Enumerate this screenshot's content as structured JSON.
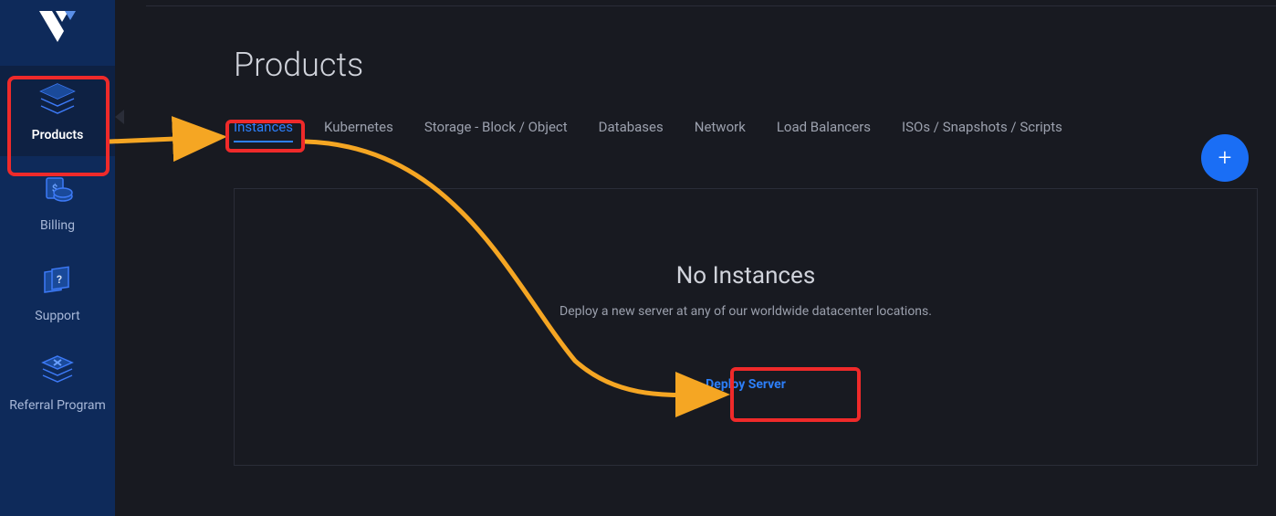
{
  "sidebar": {
    "items": [
      {
        "label": "Products"
      },
      {
        "label": "Billing"
      },
      {
        "label": "Support"
      },
      {
        "label": "Referral Program"
      }
    ]
  },
  "page": {
    "title": "Products"
  },
  "tabs": [
    {
      "label": "Instances"
    },
    {
      "label": "Kubernetes"
    },
    {
      "label": "Storage - Block / Object"
    },
    {
      "label": "Databases"
    },
    {
      "label": "Network"
    },
    {
      "label": "Load Balancers"
    },
    {
      "label": "ISOs / Snapshots / Scripts"
    }
  ],
  "empty": {
    "title": "No Instances",
    "subtitle": "Deploy a new server at any of our worldwide datacenter locations.",
    "button": "Deploy Server"
  },
  "colors": {
    "accent": "#2d7ff9",
    "highlight": "#ef2a2a",
    "arrow": "#f5a623"
  }
}
